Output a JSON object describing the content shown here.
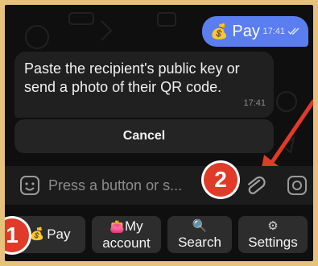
{
  "chat": {
    "pay_bubble": {
      "text": "Pay",
      "time": "17:41",
      "icon": "money-bag-icon"
    },
    "message": {
      "text": "Paste the recipient's public key or send a photo of their QR code.",
      "time": "17:41"
    },
    "cancel_label": "Cancel"
  },
  "input": {
    "placeholder": "Press a button or s...",
    "emoji_icon": "sticker-icon",
    "attach_icon": "paperclip-icon",
    "camera_icon": "camera-icon"
  },
  "keyboard": {
    "pay": {
      "label": "Pay",
      "icon": "money-bag-icon"
    },
    "my_account": {
      "label_1": "My",
      "label_2": "account",
      "icon": "purse-icon"
    },
    "search": {
      "label": "Search",
      "icon": "magnifier-icon"
    },
    "settings": {
      "label": "Settings",
      "icon": "gear-icon"
    }
  },
  "annotations": {
    "badge_1": "1",
    "badge_2": "2"
  },
  "colors": {
    "accent": "#5a7df0",
    "badge": "#e03a28",
    "background": "#0f0f0f"
  }
}
